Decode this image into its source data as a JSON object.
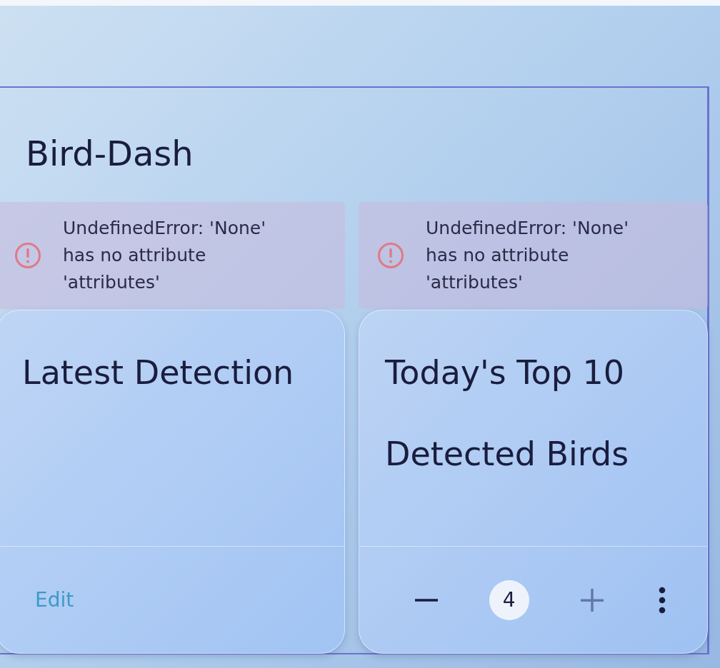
{
  "dashboard": {
    "title": "Bird-Dash"
  },
  "errors": [
    {
      "message": "UndefinedError: 'None' has no attribute 'attributes'"
    },
    {
      "message": "UndefinedError: 'None' has no attribute 'attributes'"
    }
  ],
  "cards": [
    {
      "title_lines": [
        "Latest Detection"
      ],
      "footer": {
        "kind": "edit",
        "label": "Edit"
      }
    },
    {
      "title_lines": [
        "Today's Top 10",
        "Detected Birds"
      ],
      "footer": {
        "kind": "stepper",
        "value": "4",
        "decrease_disabled": false,
        "increase_disabled": true
      }
    }
  ]
}
